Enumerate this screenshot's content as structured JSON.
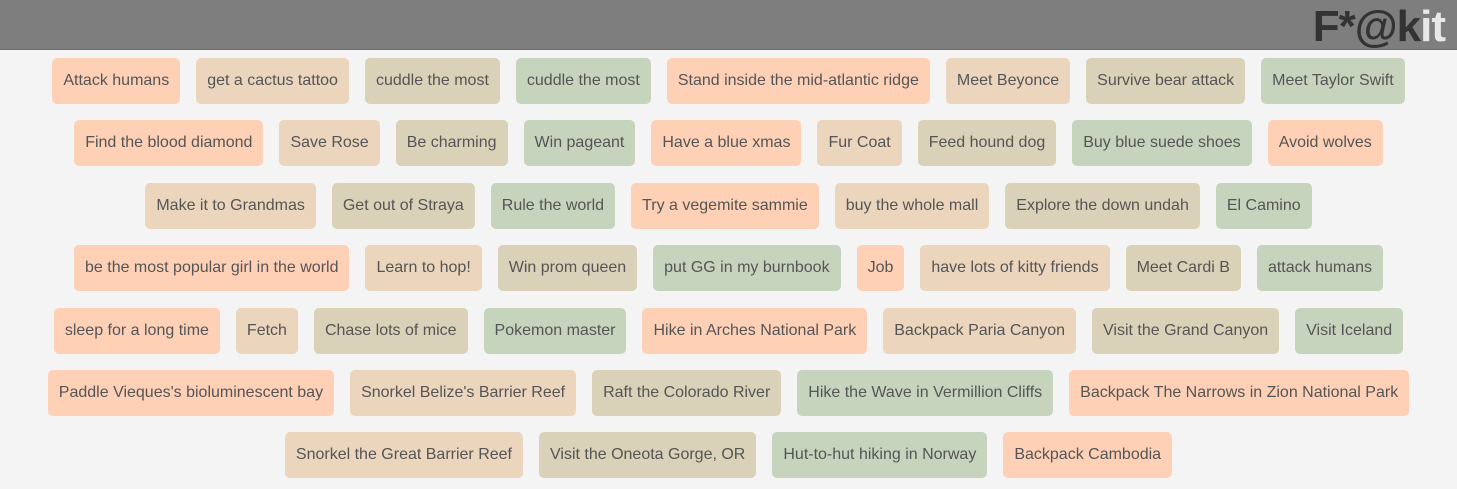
{
  "header": {
    "logo_dark": "F*@k",
    "logo_light": "it"
  },
  "colors": {
    "header_bg": "#7e7e7e",
    "page_bg": "#f4f4f4",
    "tag_peach": "#fed1b7",
    "tag_tan": "#ebd5bd",
    "tag_khaki": "#d9d2b8",
    "tag_sage": "#c6d4bd",
    "tag_text": "#555555"
  },
  "rows": [
    [
      "Attack humans",
      "get a cactus tattoo",
      "cuddle the most",
      "cuddle the most",
      "Stand inside the mid-atlantic ridge",
      "Meet Beyonce",
      "Survive bear attack",
      "Meet Taylor Swift"
    ],
    [
      "Find the blood diamond",
      "Save Rose",
      "Be charming",
      "Win pageant",
      "Have a blue xmas",
      "Fur Coat",
      "Feed hound dog",
      "Buy blue suede shoes",
      "Avoid wolves"
    ],
    [
      "Make it to Grandmas",
      "Get out of Straya",
      "Rule the world",
      "Try a vegemite sammie",
      "buy the whole mall",
      "Explore the down undah",
      "El Camino"
    ],
    [
      "be the most popular girl in the world",
      "Learn to hop!",
      "Win prom queen",
      "put GG in my burnbook",
      "Job",
      "have lots of kitty friends",
      "Meet Cardi B",
      "attack humans"
    ],
    [
      "sleep for a long time",
      "Fetch",
      "Chase lots of mice",
      "Pokemon master",
      "Hike in Arches National Park",
      "Backpack Paria Canyon",
      "Visit the Grand Canyon",
      "Visit Iceland"
    ],
    [
      "Paddle Vieques's bioluminescent bay",
      "Snorkel Belize's Barrier Reef",
      "Raft the Colorado River",
      "Hike the Wave in Vermillion Cliffs",
      "Backpack The Narrows in Zion National Park"
    ],
    [
      "Snorkel the Great Barrier Reef",
      "Visit the Oneota Gorge, OR",
      "Hut-to-hut hiking in Norway",
      "Backpack Cambodia"
    ]
  ]
}
